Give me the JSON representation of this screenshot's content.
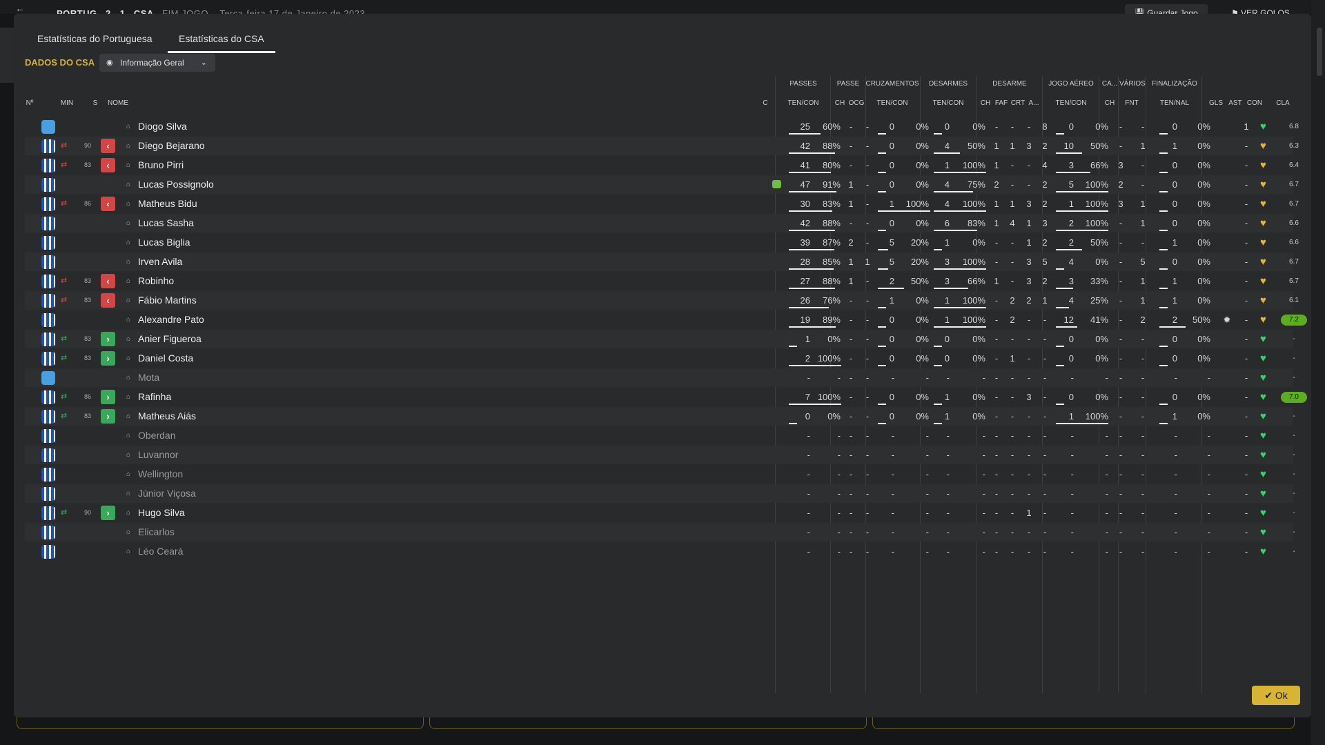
{
  "topbar": {
    "back_icon": "back-arrow-icon",
    "home_team": "PORTUG",
    "score": "2 - 1",
    "away_team": "CSA",
    "status": "FIM JOGO",
    "date": "Terça-feira 17 de Janeiro de 2023",
    "save_label": "Guardar Jogo",
    "goals_label": "VER GOLOS"
  },
  "tabs": [
    "Estatísticas do Portuguesa",
    "Estatísticas do CSA"
  ],
  "section_label": "DADOS DO CSA",
  "view_dropdown": {
    "label": "Informação Geral",
    "icon": "eye-icon"
  },
  "group_headers": {
    "passes": "PASSES",
    "passe": "PASSE",
    "cruzamentos": "CRUZAMENTOS",
    "desarmes": "DESARMES",
    "desarme": "DESARME",
    "jogo_aereo": "JOGO AÉREO",
    "ca": "CA...",
    "varios": "VÁRIOS",
    "finalizacao": "FINALIZAÇÃO"
  },
  "column_headers": {
    "no": "Nº",
    "min": "MIN",
    "s": "S",
    "nome": "NOME",
    "c": "C",
    "passes": "TEN/CON",
    "passe_ch": "CH",
    "passe_ocg": "OCG",
    "cruz": "TEN/CON",
    "des": "TEN/CON",
    "ch": "CH",
    "faf": "FAF",
    "crt": "CRT",
    "a": "A...",
    "aereo": "TEN/CON",
    "ca_ch": "CH",
    "fnt": "FNT",
    "fin": "TEN/NAL",
    "gls": "GLS",
    "ast": "AST",
    "con": "CON",
    "cla": "CLA"
  },
  "colors": {
    "accent": "#d4b23a",
    "sub_out": "#d64545",
    "sub_in": "#3aa85a",
    "heart_green": "#37d26a",
    "heart_yellow": "#e3b33a",
    "rating_high": "#5cae1e"
  },
  "players": [
    {
      "kit": "gk",
      "name": "Diogo Silva",
      "pt": "25",
      "pp": "60%",
      "pf": 0.6,
      "pch": "-",
      "pocg": "-",
      "ct": "0",
      "cp": "0%",
      "cf": 0,
      "dt": "0",
      "dp": "0%",
      "df": 0,
      "dch": "-",
      "faf": "-",
      "crt": "-",
      "da": "8",
      "at": "0",
      "ap": "0%",
      "af": 0,
      "cach": "-",
      "fnt": "-",
      "ft": "0",
      "fp": "0%",
      "ff": 0,
      "gls": "",
      "ast": "1",
      "heart": "green",
      "cla": "6.8",
      "hi": false
    },
    {
      "kit": "out",
      "name": "Diego Bejarano",
      "sub": "out",
      "min": "90",
      "pt": "42",
      "pp": "88%",
      "pf": 0.88,
      "pch": "-",
      "pocg": "-",
      "ct": "0",
      "cp": "0%",
      "cf": 0,
      "dt": "4",
      "dp": "50%",
      "df": 0.5,
      "dch": "1",
      "faf": "1",
      "crt": "3",
      "da": "2",
      "at": "10",
      "ap": "50%",
      "af": 0.5,
      "cach": "-",
      "fnt": "1",
      "ft": "1",
      "fp": "0%",
      "ff": 0,
      "gls": "",
      "ast": "-",
      "heart": "yellow",
      "cla": "6.3",
      "hi": false
    },
    {
      "kit": "out",
      "name": "Bruno Pirri",
      "sub": "out",
      "min": "83",
      "pt": "41",
      "pp": "80%",
      "pf": 0.8,
      "pch": "-",
      "pocg": "-",
      "ct": "0",
      "cp": "0%",
      "cf": 0,
      "dt": "1",
      "dp": "100%",
      "df": 1,
      "dch": "1",
      "faf": "-",
      "crt": "-",
      "da": "4",
      "at": "3",
      "ap": "66%",
      "af": 0.66,
      "cach": "3",
      "fnt": "-",
      "ft": "0",
      "fp": "0%",
      "ff": 0,
      "gls": "",
      "ast": "-",
      "heart": "yellow",
      "cla": "6.4",
      "hi": false
    },
    {
      "kit": "out",
      "name": "Lucas Possignolo",
      "card": true,
      "pt": "47",
      "pp": "91%",
      "pf": 0.91,
      "pch": "1",
      "pocg": "-",
      "ct": "0",
      "cp": "0%",
      "cf": 0,
      "dt": "4",
      "dp": "75%",
      "df": 0.75,
      "dch": "2",
      "faf": "-",
      "crt": "-",
      "da": "2",
      "at": "5",
      "ap": "100%",
      "af": 1,
      "cach": "2",
      "fnt": "-",
      "ft": "0",
      "fp": "0%",
      "ff": 0,
      "gls": "",
      "ast": "-",
      "heart": "yellow",
      "cla": "6.7",
      "hi": false
    },
    {
      "kit": "out",
      "name": "Matheus Bidu",
      "sub": "out",
      "min": "86",
      "pt": "30",
      "pp": "83%",
      "pf": 0.83,
      "pch": "1",
      "pocg": "-",
      "ct": "1",
      "cp": "100%",
      "cf": 1,
      "dt": "4",
      "dp": "100%",
      "df": 1,
      "dch": "1",
      "faf": "1",
      "crt": "3",
      "da": "2",
      "at": "1",
      "ap": "100%",
      "af": 1,
      "cach": "3",
      "fnt": "1",
      "ft": "0",
      "fp": "0%",
      "ff": 0,
      "gls": "",
      "ast": "-",
      "heart": "yellow",
      "cla": "6.7",
      "hi": false
    },
    {
      "kit": "out",
      "name": "Lucas Sasha",
      "pt": "42",
      "pp": "88%",
      "pf": 0.88,
      "pch": "-",
      "pocg": "-",
      "ct": "0",
      "cp": "0%",
      "cf": 0,
      "dt": "6",
      "dp": "83%",
      "df": 0.83,
      "dch": "1",
      "faf": "4",
      "crt": "1",
      "da": "3",
      "at": "2",
      "ap": "100%",
      "af": 1,
      "cach": "-",
      "fnt": "1",
      "ft": "0",
      "fp": "0%",
      "ff": 0,
      "gls": "",
      "ast": "-",
      "heart": "yellow",
      "cla": "6.6",
      "hi": false
    },
    {
      "kit": "out",
      "name": "Lucas Biglia",
      "pt": "39",
      "pp": "87%",
      "pf": 0.87,
      "pch": "2",
      "pocg": "-",
      "ct": "5",
      "cp": "20%",
      "cf": 0.2,
      "dt": "1",
      "dp": "0%",
      "df": 0,
      "dch": "-",
      "faf": "-",
      "crt": "1",
      "da": "2",
      "at": "2",
      "ap": "50%",
      "af": 0.5,
      "cach": "-",
      "fnt": "-",
      "ft": "1",
      "fp": "0%",
      "ff": 0,
      "gls": "",
      "ast": "-",
      "heart": "yellow",
      "cla": "6.6",
      "hi": false
    },
    {
      "kit": "out",
      "name": "Irven Avila",
      "pt": "28",
      "pp": "85%",
      "pf": 0.85,
      "pch": "1",
      "pocg": "1",
      "ct": "5",
      "cp": "20%",
      "cf": 0.2,
      "dt": "3",
      "dp": "100%",
      "df": 1,
      "dch": "-",
      "faf": "-",
      "crt": "3",
      "da": "5",
      "at": "4",
      "ap": "0%",
      "af": 0,
      "cach": "-",
      "fnt": "5",
      "ft": "0",
      "fp": "0%",
      "ff": 0,
      "gls": "",
      "ast": "-",
      "heart": "yellow",
      "cla": "6.7",
      "hi": false
    },
    {
      "kit": "out",
      "name": "Robinho",
      "sub": "out",
      "min": "83",
      "pt": "27",
      "pp": "88%",
      "pf": 0.88,
      "pch": "1",
      "pocg": "-",
      "ct": "2",
      "cp": "50%",
      "cf": 0.5,
      "dt": "3",
      "dp": "66%",
      "df": 0.66,
      "dch": "1",
      "faf": "-",
      "crt": "3",
      "da": "2",
      "at": "3",
      "ap": "33%",
      "af": 0.33,
      "cach": "-",
      "fnt": "1",
      "ft": "1",
      "fp": "0%",
      "ff": 0,
      "gls": "",
      "ast": "-",
      "heart": "yellow",
      "cla": "6.7",
      "hi": false
    },
    {
      "kit": "out",
      "name": "Fábio Martins",
      "sub": "out",
      "min": "83",
      "pt": "26",
      "pp": "76%",
      "pf": 0.76,
      "pch": "-",
      "pocg": "-",
      "ct": "1",
      "cp": "0%",
      "cf": 0,
      "dt": "1",
      "dp": "100%",
      "df": 1,
      "dch": "-",
      "faf": "2",
      "crt": "2",
      "da": "1",
      "at": "4",
      "ap": "25%",
      "af": 0.25,
      "cach": "-",
      "fnt": "1",
      "ft": "1",
      "fp": "0%",
      "ff": 0,
      "gls": "",
      "ast": "-",
      "heart": "yellow",
      "cla": "6.1",
      "hi": false
    },
    {
      "kit": "out",
      "name": "Alexandre Pato",
      "pt": "19",
      "pp": "89%",
      "pf": 0.89,
      "pch": "-",
      "pocg": "-",
      "ct": "0",
      "cp": "0%",
      "cf": 0,
      "dt": "1",
      "dp": "100%",
      "df": 1,
      "dch": "-",
      "faf": "2",
      "crt": "-",
      "da": "-",
      "at": "12",
      "ap": "41%",
      "af": 0.41,
      "cach": "-",
      "fnt": "2",
      "ft": "2",
      "fp": "50%",
      "ff": 0.5,
      "gls": "ball",
      "ast": "-",
      "heart": "yellow",
      "cla": "7.2",
      "hi": true
    },
    {
      "kit": "out",
      "name": "Anier Figueroa",
      "sub": "in",
      "min": "83",
      "pt": "1",
      "pp": "0%",
      "pf": 0,
      "pch": "-",
      "pocg": "-",
      "ct": "0",
      "cp": "0%",
      "cf": 0,
      "dt": "0",
      "dp": "0%",
      "df": 0,
      "dch": "-",
      "faf": "-",
      "crt": "-",
      "da": "-",
      "at": "0",
      "ap": "0%",
      "af": 0,
      "cach": "-",
      "fnt": "-",
      "ft": "0",
      "fp": "0%",
      "ff": 0,
      "gls": "",
      "ast": "-",
      "heart": "green",
      "cla": "-",
      "hi": false
    },
    {
      "kit": "out",
      "name": "Daniel Costa",
      "sub": "in",
      "min": "83",
      "pt": "2",
      "pp": "100%",
      "pf": 1,
      "pch": "-",
      "pocg": "-",
      "ct": "0",
      "cp": "0%",
      "cf": 0,
      "dt": "0",
      "dp": "0%",
      "df": 0,
      "dch": "-",
      "faf": "1",
      "crt": "-",
      "da": "-",
      "at": "0",
      "ap": "0%",
      "af": 0,
      "cach": "-",
      "fnt": "-",
      "ft": "0",
      "fp": "0%",
      "ff": 0,
      "gls": "",
      "ast": "-",
      "heart": "green",
      "cla": "-",
      "hi": false
    },
    {
      "kit": "gk",
      "name": "Mota",
      "dim": true,
      "pt": "-",
      "pp": "-",
      "pch": "-",
      "pocg": "-",
      "ct": "-",
      "cp": "-",
      "dt": "-",
      "dp": "-",
      "dch": "-",
      "faf": "-",
      "crt": "-",
      "da": "-",
      "at": "-",
      "ap": "-",
      "cach": "-",
      "fnt": "-",
      "ft": "-",
      "fp": "-",
      "gls": "",
      "ast": "-",
      "heart": "green",
      "cla": "-",
      "hi": false
    },
    {
      "kit": "out",
      "name": "Rafinha",
      "sub": "in",
      "min": "86",
      "pt": "7",
      "pp": "100%",
      "pf": 1,
      "pch": "-",
      "pocg": "-",
      "ct": "0",
      "cp": "0%",
      "cf": 0,
      "dt": "1",
      "dp": "0%",
      "df": 0,
      "dch": "-",
      "faf": "-",
      "crt": "3",
      "da": "-",
      "at": "0",
      "ap": "0%",
      "af": 0,
      "cach": "-",
      "fnt": "-",
      "ft": "0",
      "fp": "0%",
      "ff": 0,
      "gls": "",
      "ast": "-",
      "heart": "green",
      "cla": "7.0",
      "hi": true
    },
    {
      "kit": "out",
      "name": "Matheus Aiás",
      "sub": "in",
      "min": "83",
      "pt": "0",
      "pp": "0%",
      "pf": 0,
      "pch": "-",
      "pocg": "-",
      "ct": "0",
      "cp": "0%",
      "cf": 0,
      "dt": "1",
      "dp": "0%",
      "df": 0,
      "dch": "-",
      "faf": "-",
      "crt": "-",
      "da": "-",
      "at": "1",
      "ap": "100%",
      "af": 1,
      "cach": "-",
      "fnt": "-",
      "ft": "1",
      "fp": "0%",
      "ff": 0,
      "gls": "",
      "ast": "-",
      "heart": "green",
      "cla": "-",
      "hi": false
    },
    {
      "kit": "out",
      "name": "Oberdan",
      "dim": true,
      "pt": "-",
      "pp": "-",
      "pch": "-",
      "pocg": "-",
      "ct": "-",
      "cp": "-",
      "dt": "-",
      "dp": "-",
      "dch": "-",
      "faf": "-",
      "crt": "-",
      "da": "-",
      "at": "-",
      "ap": "-",
      "cach": "-",
      "fnt": "-",
      "ft": "-",
      "fp": "-",
      "gls": "",
      "ast": "-",
      "heart": "green",
      "cla": "-",
      "hi": false
    },
    {
      "kit": "out",
      "name": "Luvannor",
      "dim": true,
      "pt": "-",
      "pp": "-",
      "pch": "-",
      "pocg": "-",
      "ct": "-",
      "cp": "-",
      "dt": "-",
      "dp": "-",
      "dch": "-",
      "faf": "-",
      "crt": "-",
      "da": "-",
      "at": "-",
      "ap": "-",
      "cach": "-",
      "fnt": "-",
      "ft": "-",
      "fp": "-",
      "gls": "",
      "ast": "-",
      "heart": "green",
      "cla": "-",
      "hi": false
    },
    {
      "kit": "out",
      "name": "Wellington",
      "dim": true,
      "pt": "-",
      "pp": "-",
      "pch": "-",
      "pocg": "-",
      "ct": "-",
      "cp": "-",
      "dt": "-",
      "dp": "-",
      "dch": "-",
      "faf": "-",
      "crt": "-",
      "da": "-",
      "at": "-",
      "ap": "-",
      "cach": "-",
      "fnt": "-",
      "ft": "-",
      "fp": "-",
      "gls": "",
      "ast": "-",
      "heart": "green",
      "cla": "-",
      "hi": false
    },
    {
      "kit": "out",
      "name": "Júnior Viçosa",
      "dim": true,
      "pt": "-",
      "pp": "-",
      "pch": "-",
      "pocg": "-",
      "ct": "-",
      "cp": "-",
      "dt": "-",
      "dp": "-",
      "dch": "-",
      "faf": "-",
      "crt": "-",
      "da": "-",
      "at": "-",
      "ap": "-",
      "cach": "-",
      "fnt": "-",
      "ft": "-",
      "fp": "-",
      "gls": "",
      "ast": "-",
      "heart": "green",
      "cla": "-",
      "hi": false
    },
    {
      "kit": "out",
      "name": "Hugo Silva",
      "sub": "in",
      "min": "90",
      "pt": "-",
      "pp": "-",
      "pch": "-",
      "pocg": "-",
      "ct": "-",
      "cp": "-",
      "dt": "-",
      "dp": "-",
      "dch": "-",
      "faf": "-",
      "crt": "1",
      "da": "-",
      "at": "-",
      "ap": "-",
      "cach": "-",
      "fnt": "-",
      "ft": "-",
      "fp": "-",
      "gls": "",
      "ast": "-",
      "heart": "green",
      "cla": "-",
      "hi": false
    },
    {
      "kit": "out",
      "name": "Elicarlos",
      "dim": true,
      "pt": "-",
      "pp": "-",
      "pch": "-",
      "pocg": "-",
      "ct": "-",
      "cp": "-",
      "dt": "-",
      "dp": "-",
      "dch": "-",
      "faf": "-",
      "crt": "-",
      "da": "-",
      "at": "-",
      "ap": "-",
      "cach": "-",
      "fnt": "-",
      "ft": "-",
      "fp": "-",
      "gls": "",
      "ast": "-",
      "heart": "green",
      "cla": "-",
      "hi": false
    },
    {
      "kit": "out",
      "name": "Léo Ceará",
      "dim": true,
      "pt": "-",
      "pp": "-",
      "pch": "-",
      "pocg": "-",
      "ct": "-",
      "cp": "-",
      "dt": "-",
      "dp": "-",
      "dch": "-",
      "faf": "-",
      "crt": "-",
      "da": "-",
      "at": "-",
      "ap": "-",
      "cach": "-",
      "fnt": "-",
      "ft": "-",
      "fp": "-",
      "gls": "",
      "ast": "-",
      "heart": "green",
      "cla": "-",
      "hi": false
    }
  ],
  "ok_button": {
    "label": "Ok",
    "icon": "check-icon"
  }
}
